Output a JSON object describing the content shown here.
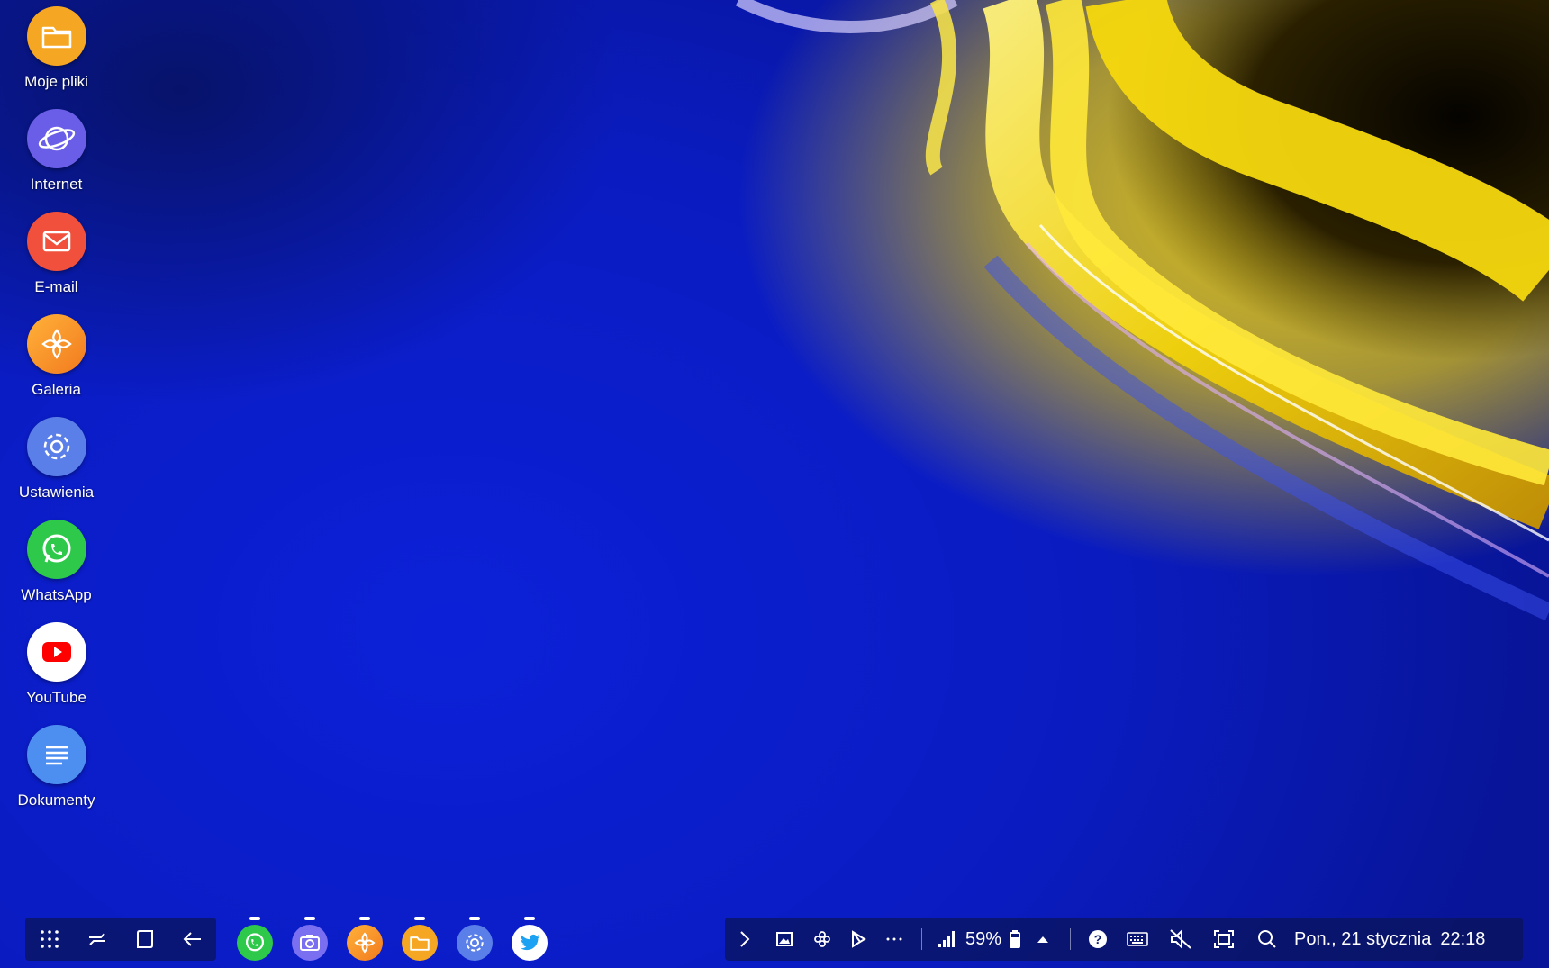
{
  "desktop": {
    "icons": [
      {
        "label": "Moje pliki",
        "icon": "folder-icon",
        "color": "#f5a623"
      },
      {
        "label": "Internet",
        "icon": "planet-icon",
        "color": "#6a5ee8"
      },
      {
        "label": "E-mail",
        "icon": "mail-icon",
        "color": "#f0503c"
      },
      {
        "label": "Galeria",
        "icon": "flower-icon",
        "color": "#f7902a"
      },
      {
        "label": "Ustawienia",
        "icon": "gear-icon",
        "color": "#5b7fe8"
      },
      {
        "label": "WhatsApp",
        "icon": "whatsapp-icon",
        "color": "#2ec94a"
      },
      {
        "label": "YouTube",
        "icon": "youtube-icon",
        "color": "#ffffff"
      },
      {
        "label": "Dokumenty",
        "icon": "document-icon",
        "color": "#4d8ff0"
      }
    ]
  },
  "taskbar": {
    "nav_buttons": [
      "apps-grid-icon",
      "recents-icon",
      "home-icon",
      "back-icon"
    ],
    "dock_apps": [
      "whatsapp-icon",
      "camera-icon",
      "gallery-icon",
      "files-icon",
      "settings-icon",
      "twitter-icon"
    ],
    "tray": {
      "battery_percent": "59%",
      "date": "Pon., 21 stycznia",
      "time": "22:18"
    }
  }
}
